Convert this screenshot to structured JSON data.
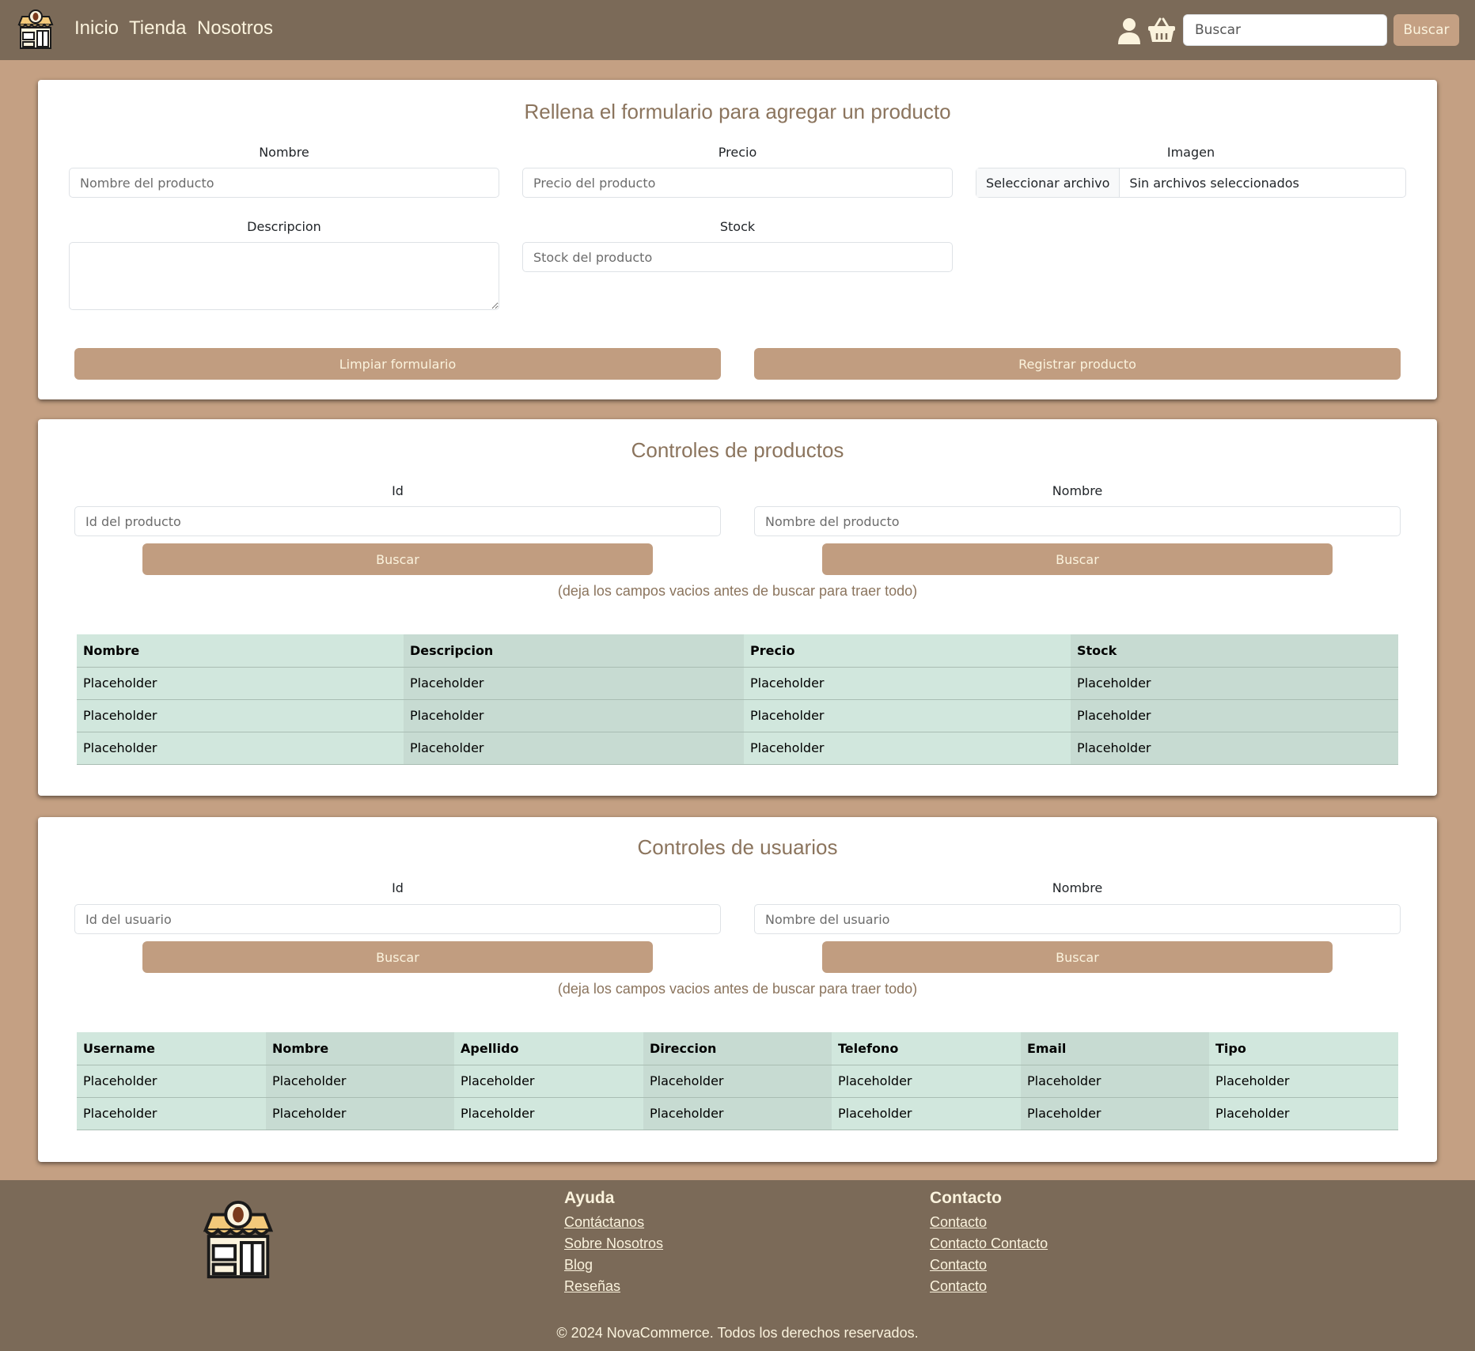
{
  "nav": {
    "links": [
      "Inicio",
      "Tienda",
      "Nosotros"
    ],
    "search_placeholder": "Buscar",
    "search_button": "Buscar"
  },
  "product_form": {
    "title": "Rellena el formulario para agregar un producto",
    "nombre_label": "Nombre",
    "nombre_placeholder": "Nombre del producto",
    "precio_label": "Precio",
    "precio_placeholder": "Precio del producto",
    "imagen_label": "Imagen",
    "file_button": "Seleccionar archivo",
    "file_status": "Sin archivos seleccionados",
    "descripcion_label": "Descripcion",
    "stock_label": "Stock",
    "stock_placeholder": "Stock del producto",
    "clear_button": "Limpiar formulario",
    "submit_button": "Registrar producto"
  },
  "product_controls": {
    "title": "Controles de productos",
    "id_label": "Id",
    "id_placeholder": "Id del producto",
    "nombre_label": "Nombre",
    "nombre_placeholder": "Nombre del producto",
    "search_button": "Buscar",
    "hint": "(deja los campos vacios antes de buscar para traer todo)",
    "table": {
      "headers": [
        "Nombre",
        "Descripcion",
        "Precio",
        "Stock"
      ],
      "rows": [
        [
          "Placeholder",
          "Placeholder",
          "Placeholder",
          "Placeholder"
        ],
        [
          "Placeholder",
          "Placeholder",
          "Placeholder",
          "Placeholder"
        ],
        [
          "Placeholder",
          "Placeholder",
          "Placeholder",
          "Placeholder"
        ]
      ]
    }
  },
  "user_controls": {
    "title": "Controles de usuarios",
    "id_label": "Id",
    "id_placeholder": "Id del usuario",
    "nombre_label": "Nombre",
    "nombre_placeholder": "Nombre del usuario",
    "search_button": "Buscar",
    "hint": "(deja los campos vacios antes de buscar para traer todo)",
    "table": {
      "headers": [
        "Username",
        "Nombre",
        "Apellido",
        "Direccion",
        "Telefono",
        "Email",
        "Tipo"
      ],
      "rows": [
        [
          "Placeholder",
          "Placeholder",
          "Placeholder",
          "Placeholder",
          "Placeholder",
          "Placeholder",
          "Placeholder"
        ],
        [
          "Placeholder",
          "Placeholder",
          "Placeholder",
          "Placeholder",
          "Placeholder",
          "Placeholder",
          "Placeholder"
        ]
      ]
    }
  },
  "footer": {
    "ayuda_title": "Ayuda",
    "ayuda_links": [
      "Contáctanos",
      "Sobre Nosotros",
      "Blog",
      "Reseñas"
    ],
    "contacto_title": "Contacto",
    "contacto_links": [
      "Contacto",
      "Contacto Contacto",
      "Contacto",
      "Contacto"
    ],
    "copyright": "© 2024 NovaCommerce. Todos los derechos reservados."
  },
  "colors": {
    "page_bg": "#c4a083",
    "nav_bg": "#7b6a58",
    "accent_button": "#c19d80",
    "title_text": "#8b745d",
    "light_text": "#fbf3dd",
    "table_cell": "#d1e7dd"
  },
  "icons": {
    "logo": "coffee-shop-storefront-icon",
    "user": "user-icon",
    "cart": "basket-icon"
  }
}
